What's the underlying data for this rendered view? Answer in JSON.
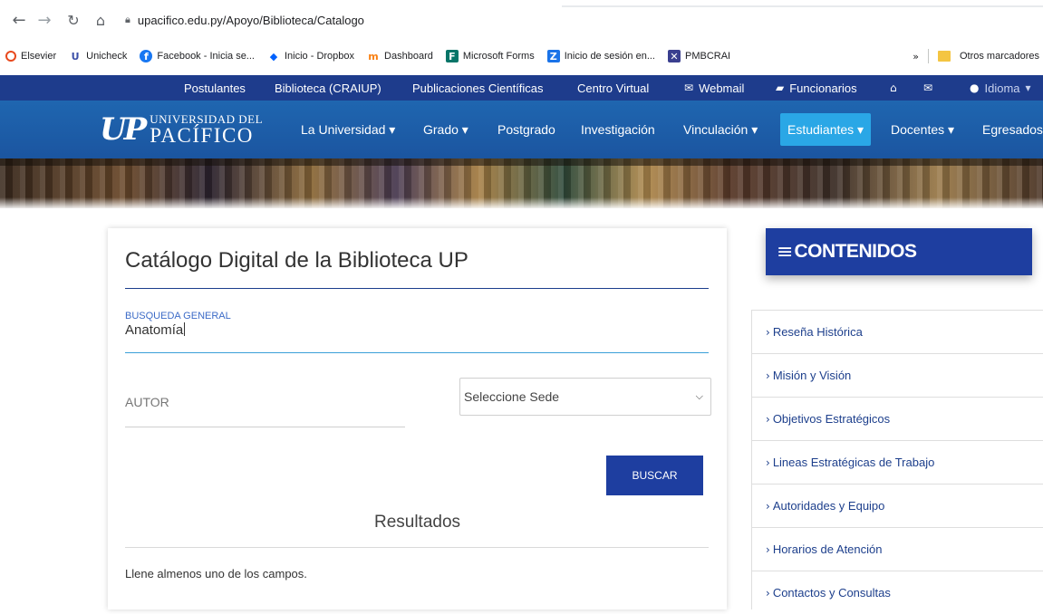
{
  "browser": {
    "url": "upacifico.edu.py/Apoyo/Biblioteca/Catalogo",
    "bookmarks": [
      {
        "label": "Elsevier",
        "icon": "elsevier-icon",
        "color": "#e8491d"
      },
      {
        "label": "Unicheck",
        "icon": "unicheck-icon",
        "color": "#3b4fa8"
      },
      {
        "label": "Facebook - Inicia se...",
        "icon": "facebook-icon",
        "color": "#1877f2"
      },
      {
        "label": "Inicio - Dropbox",
        "icon": "dropbox-icon",
        "color": "#0061fe"
      },
      {
        "label": "Dashboard",
        "icon": "moodle-icon",
        "color": "#f98012"
      },
      {
        "label": "Microsoft Forms",
        "icon": "forms-icon",
        "color": "#077568"
      },
      {
        "label": "Inicio de sesión en...",
        "icon": "zoho-icon",
        "color": "#1a73e8"
      },
      {
        "label": "PMBCRAI",
        "icon": "pmb-icon",
        "color": "#3a3f8f"
      }
    ],
    "overflow": "»",
    "other_bookmarks": "Otros marcadores"
  },
  "topbar": {
    "postulantes": "Postulantes",
    "biblioteca": "Biblioteca (CRAIUP)",
    "publicaciones": "Publicaciones Científicas",
    "centro_virtual": "Centro Virtual",
    "webmail": "Webmail",
    "funcionarios": "Funcionarios",
    "idioma": "Idioma"
  },
  "logo": {
    "mark": "UP",
    "line1": "UNIVERSIDAD DEL",
    "line2": "PACÍFICO"
  },
  "mainnav": {
    "universidad": "La Universidad ▾",
    "grado": "Grado ▾",
    "postgrado": "Postgrado",
    "investigacion": "Investigación",
    "vinculacion": "Vinculación ▾",
    "estudiantes": "Estudiantes ▾",
    "docentes": "Docentes ▾",
    "egresados": "Egresados"
  },
  "catalog": {
    "title": "Catálogo Digital de la Biblioteca UP",
    "search_label": "BUSQUEDA GENERAL",
    "search_value": "Anatomía",
    "autor_label": "AUTOR",
    "sede_selected": "Seleccione Sede",
    "buscar_label": "BUSCAR",
    "resultados_title": "Resultados",
    "message": "Llene almenos uno de los campos."
  },
  "sidebar": {
    "title": "CONTENIDOS",
    "items": [
      {
        "label": "Reseña Histórica"
      },
      {
        "label": "Misión y Visión"
      },
      {
        "label": "Objetivos Estratégicos"
      },
      {
        "label": "Lineas Estratégicas de Trabajo"
      },
      {
        "label": "Autoridades y Equipo"
      },
      {
        "label": "Horarios de Atención"
      },
      {
        "label": "Contactos y Consultas"
      }
    ]
  },
  "colors": {
    "topbar": "#1e3c8c",
    "mainnav": "#1f66b0",
    "active_nav": "#2aa7e6",
    "primary_button": "#1e3ea0",
    "link": "#1d3f8c"
  }
}
